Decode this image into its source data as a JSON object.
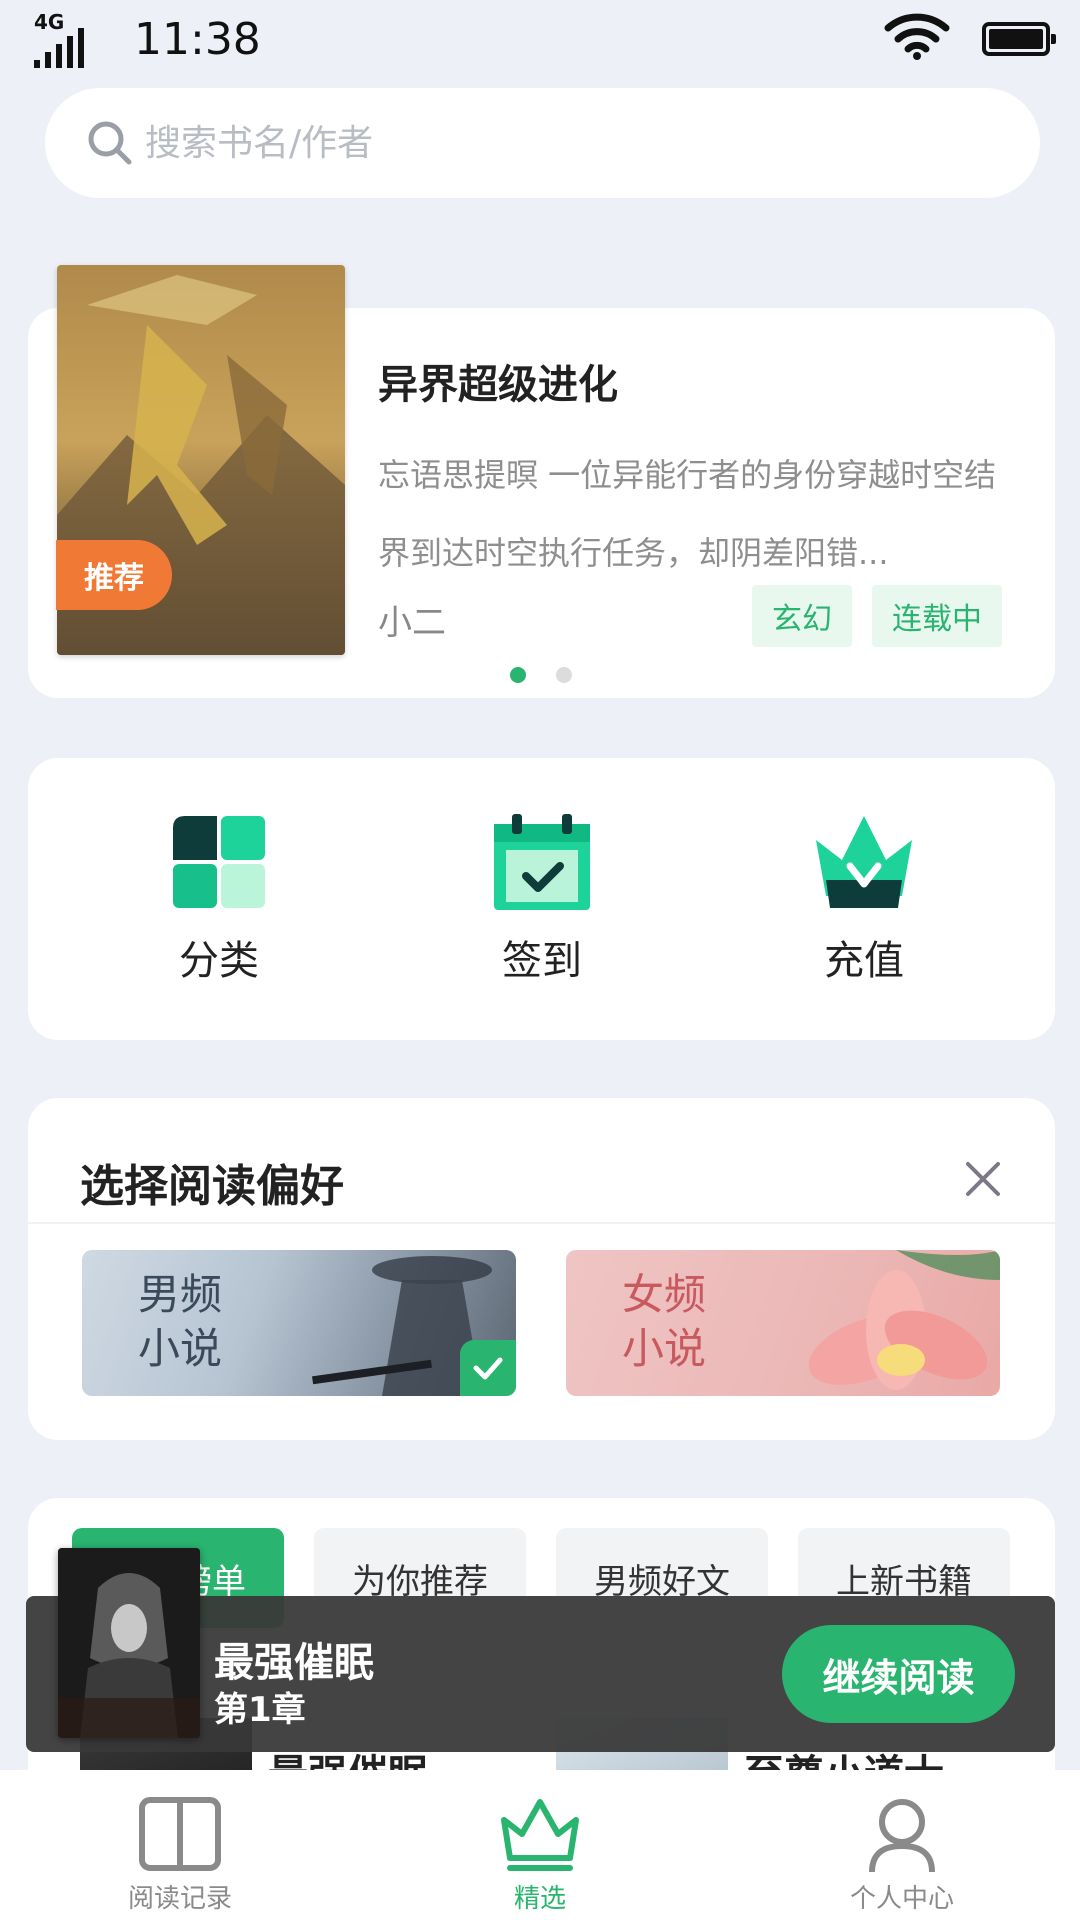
{
  "status_bar": {
    "network": "4G",
    "time": "11:38"
  },
  "search": {
    "placeholder": "搜索书名/作者",
    "icon": "search-icon"
  },
  "banner": {
    "badge": "推荐",
    "title": "异界超级进化",
    "description": "忘语思提暝 一位异能行者的身份穿越时空结界到达时空执行任务，却阴差阳错...",
    "author": "小二",
    "tags": [
      "玄幻",
      "连载中"
    ],
    "page_count": 2,
    "active_page": 1
  },
  "quick_entries": [
    {
      "label": "分类",
      "icon": "category-icon"
    },
    {
      "label": "签到",
      "icon": "calendar-check-icon"
    },
    {
      "label": "充值",
      "icon": "crown-icon"
    }
  ],
  "preference": {
    "title": "选择阅读偏好",
    "close_icon": "close-icon",
    "options": [
      {
        "label_line1": "男频",
        "label_line2": "小说",
        "selected": true
      },
      {
        "label_line1": "女频",
        "label_line2": "小说",
        "selected": false
      }
    ]
  },
  "book_list": {
    "tabs": [
      {
        "label": "排行榜单",
        "active": true
      },
      {
        "label": "为你推荐",
        "active": false
      },
      {
        "label": "男频好文",
        "active": false
      },
      {
        "label": "上新书籍",
        "active": false
      }
    ],
    "books": [
      {
        "title": "最强催眠"
      },
      {
        "title": "至尊小道士"
      }
    ]
  },
  "continue_reading": {
    "title": "最强催眠",
    "chapter": "第1章",
    "button": "继续阅读"
  },
  "bottom_nav": [
    {
      "label": "阅读记录",
      "icon": "book-open-icon",
      "active": false
    },
    {
      "label": "精选",
      "icon": "crown-icon",
      "active": true
    },
    {
      "label": "个人中心",
      "icon": "user-icon",
      "active": false
    }
  ],
  "colors": {
    "accent": "#29b46f",
    "badge": "#f07a35",
    "background": "#edf1f7"
  }
}
